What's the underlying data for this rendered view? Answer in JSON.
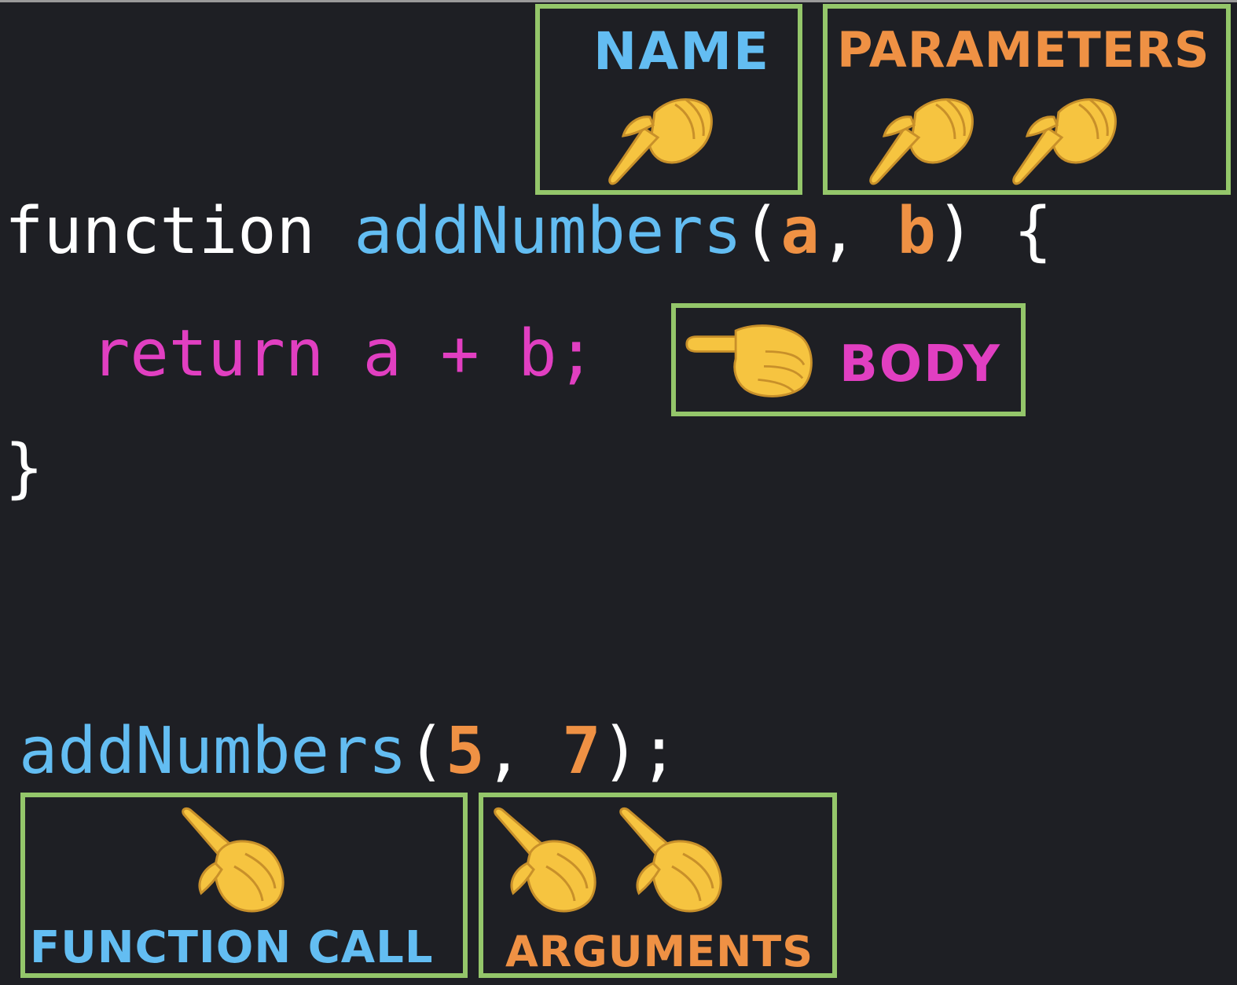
{
  "code": {
    "line1": {
      "keyword": "function",
      "name": "addNumbers",
      "open_paren": "(",
      "param_a": "a",
      "comma": ",",
      "param_b": "b",
      "close_paren": ")",
      "brace": "{"
    },
    "line2": {
      "return_kw": "return",
      "expr_a": "a",
      "plus": "+",
      "expr_b": "b;"
    },
    "line3": {
      "brace": "}"
    },
    "call": {
      "name": "addNumbers",
      "open_paren": "(",
      "arg1": "5",
      "comma": ",",
      "arg2": "7",
      "close": ");"
    }
  },
  "labels": {
    "name": "NAME",
    "parameters": "PARAMETERS",
    "body": "BODY",
    "function_call": "FUNCTION CALL",
    "arguments": "ARGUMENTS"
  },
  "icons": {
    "pointing": "pointing-hand-icon"
  },
  "colors": {
    "background": "#1e1f24",
    "function_name": "#63bdf2",
    "parameter": "#ef9144",
    "body": "#e13fc1",
    "box_border": "#94c66a",
    "hand": "#f6c440"
  }
}
